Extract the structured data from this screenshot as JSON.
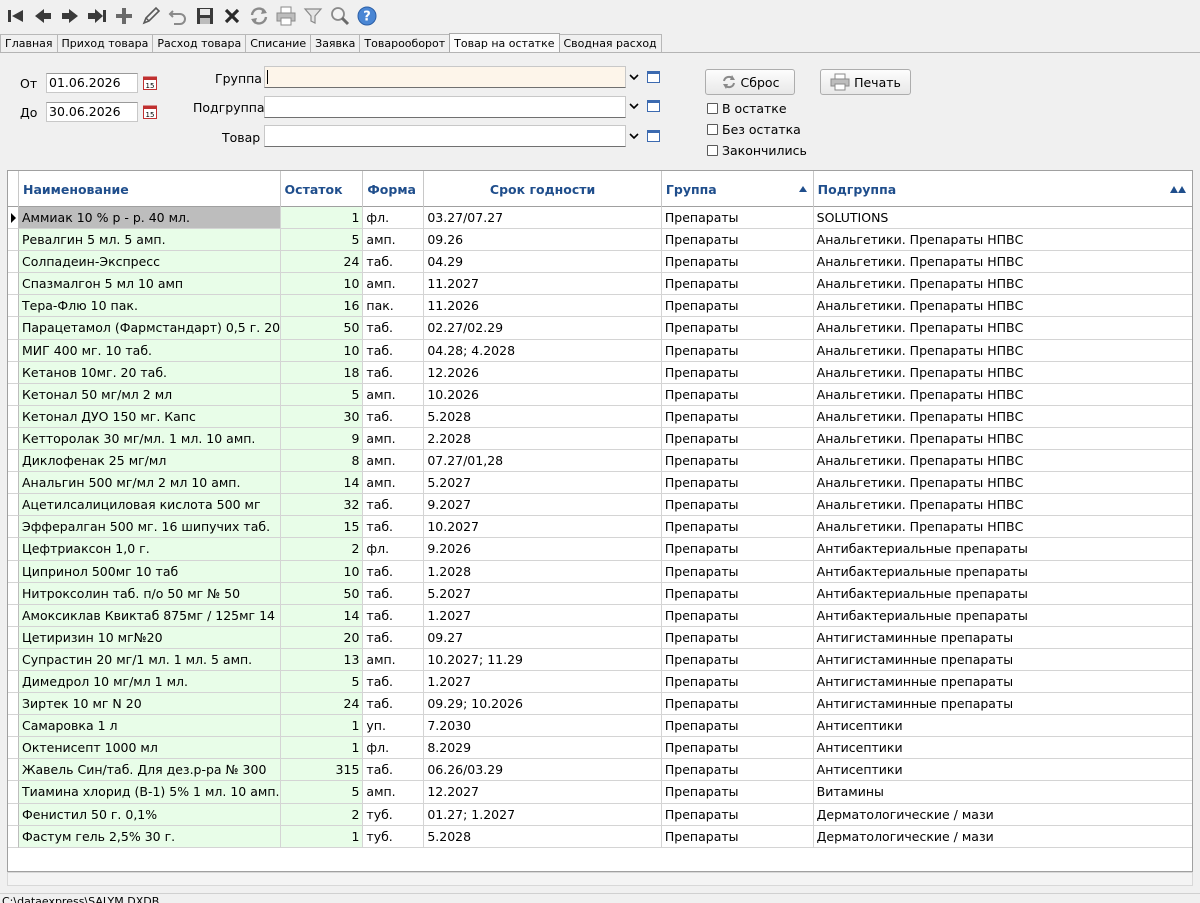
{
  "toolbar": {
    "icons": [
      "first-record-icon",
      "prev-record-icon",
      "next-record-icon",
      "last-record-icon",
      "add-icon",
      "edit-icon",
      "undo-icon",
      "save-icon",
      "delete-icon",
      "refresh-icon",
      "print-icon",
      "filter-icon",
      "search-icon",
      "help-icon"
    ]
  },
  "tabs": [
    {
      "label": "Главная"
    },
    {
      "label": "Приход товара"
    },
    {
      "label": "Расход товара"
    },
    {
      "label": "Списание"
    },
    {
      "label": "Заявка"
    },
    {
      "label": "Товарооборот"
    },
    {
      "label": "Товар на остатке",
      "active": true
    },
    {
      "label": "Сводная расход"
    }
  ],
  "filters": {
    "from_label": "От",
    "from_value": "01.06.2026",
    "to_label": "До",
    "to_value": "30.06.2026",
    "group_label": "Группа",
    "group_value": "",
    "subgroup_label": "Подгруппа",
    "subgroup_value": "",
    "product_label": "Товар",
    "product_value": "",
    "reset_label": "Сброс",
    "print_label": "Печать",
    "chk_in_stock": "В остатке",
    "chk_no_stock": "Без остатка",
    "chk_finished": "Закончились"
  },
  "grid": {
    "headers": {
      "name": "Наименование",
      "qty": "Остаток",
      "form": "Форма",
      "expiry": "Срок годности",
      "group": "Группа",
      "subgroup": "Подгруппа"
    },
    "rows": [
      [
        "Аммиак 10 % р - р. 40 мл.",
        "1",
        "фл.",
        "03.27/07.27",
        "Препараты",
        "SOLUTIONS"
      ],
      [
        "Ревалгин 5 мл. 5 амп.",
        "5",
        "амп.",
        "09.26",
        "Препараты",
        "Анальгетики. Препараты НПВС"
      ],
      [
        "Солпадеин-Экспресс",
        "24",
        "таб.",
        "04.29",
        "Препараты",
        "Анальгетики. Препараты НПВС"
      ],
      [
        "Спазмалгон 5 мл 10 амп",
        "10",
        "амп.",
        "11.2027",
        "Препараты",
        "Анальгетики. Препараты НПВС"
      ],
      [
        "Тера-Флю  10 пак.",
        "16",
        "пак.",
        "11.2026",
        "Препараты",
        "Анальгетики. Препараты НПВС"
      ],
      [
        "Парацетамол (Фармстандарт) 0,5 г. 20",
        "50",
        "таб.",
        "02.27/02.29",
        "Препараты",
        "Анальгетики. Препараты НПВС"
      ],
      [
        "МИГ  400 мг. 10 таб.",
        "10",
        "таб.",
        "04.28; 4.2028",
        "Препараты",
        "Анальгетики. Препараты НПВС"
      ],
      [
        "Кетанов 10мг. 20 таб.",
        "18",
        "таб.",
        "12.2026",
        "Препараты",
        "Анальгетики. Препараты НПВС"
      ],
      [
        "Кетонал 50 мг/мл 2 мл",
        "5",
        "амп.",
        "10.2026",
        "Препараты",
        "Анальгетики. Препараты НПВС"
      ],
      [
        "Кетонал ДУО 150 мг. Капс",
        "30",
        "таб.",
        "5.2028",
        "Препараты",
        "Анальгетики. Препараты НПВС"
      ],
      [
        "Кетторолак 30 мг/мл. 1 мл.  10 амп.",
        "9",
        "амп.",
        "2.2028",
        "Препараты",
        "Анальгетики. Препараты НПВС"
      ],
      [
        "Диклофенак 25 мг/мл",
        "8",
        "амп.",
        "07.27/01,28",
        "Препараты",
        "Анальгетики. Препараты НПВС"
      ],
      [
        "Анальгин 500 мг/мл 2 мл 10 амп.",
        "14",
        "амп.",
        "5.2027",
        "Препараты",
        "Анальгетики. Препараты НПВС"
      ],
      [
        "Ацетилсалициловая кислота 500 мг",
        "32",
        "таб.",
        "9.2027",
        "Препараты",
        "Анальгетики. Препараты НПВС"
      ],
      [
        "Эффералган  500 мг. 16 шипучих таб.",
        "15",
        "таб.",
        "10.2027",
        "Препараты",
        "Анальгетики. Препараты НПВС"
      ],
      [
        "Цефтриаксон 1,0 г.",
        "2",
        "фл.",
        "9.2026",
        "Препараты",
        "Антибактериальные препараты"
      ],
      [
        "Ципринол 500мг 10 таб",
        "10",
        "таб.",
        "1.2028",
        "Препараты",
        "Антибактериальные препараты"
      ],
      [
        "Нитроксолин таб. п/о 50 мг № 50",
        "50",
        "таб.",
        "5.2027",
        "Препараты",
        "Антибактериальные препараты"
      ],
      [
        "Амоксиклав Квиктаб 875мг / 125мг 14",
        "14",
        "таб.",
        "1.2027",
        "Препараты",
        "Антибактериальные препараты"
      ],
      [
        "Цетиризин 10 мг№20",
        "20",
        "таб.",
        "09.27",
        "Препараты",
        "Антигистаминные препараты"
      ],
      [
        "Супрастин 20 мг/1 мл. 1 мл. 5 амп.",
        "13",
        "амп.",
        "10.2027; 11.29",
        "Препараты",
        "Антигистаминные препараты"
      ],
      [
        "Димедрол  10 мг/мл 1 мл.",
        "5",
        "таб.",
        "1.2027",
        "Препараты",
        "Антигистаминные препараты"
      ],
      [
        "Зиртек 10 мг N 20",
        "24",
        "таб.",
        "09.29; 10.2026",
        "Препараты",
        "Антигистаминные препараты"
      ],
      [
        "Самаровка 1 л",
        "1",
        "уп.",
        "7.2030",
        "Препараты",
        "Антисептики"
      ],
      [
        "Октенисепт 1000 мл",
        "1",
        "фл.",
        "8.2029",
        "Препараты",
        "Антисептики"
      ],
      [
        "Жавель Син/таб. Для дез.р-ра № 300",
        "315",
        "таб.",
        "06.26/03.29",
        "Препараты",
        "Антисептики"
      ],
      [
        "Тиамина хлорид  (В-1) 5% 1 мл. 10 амп.",
        "5",
        "амп.",
        "12.2027",
        "Препараты",
        "Витамины"
      ],
      [
        "Фенистил 50 г. 0,1%",
        "2",
        "туб.",
        "01.27; 1.2027",
        "Препараты",
        "Дерматологические / мази"
      ],
      [
        "Фастум гель  2,5%  30 г.",
        "1",
        "туб.",
        "5.2028",
        "Препараты",
        "Дерматологические / мази"
      ]
    ]
  },
  "status": {
    "path": "C:\\dataexpress\\SALYM.DXDB"
  }
}
